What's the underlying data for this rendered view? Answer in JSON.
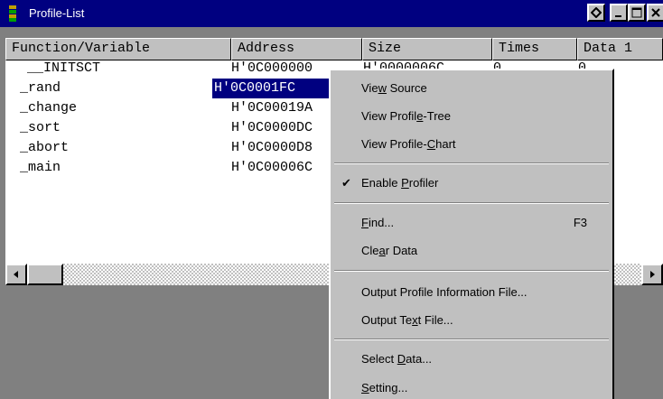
{
  "window": {
    "title": "Profile-List",
    "buttons": [
      "restore-special",
      "minimize",
      "maximize",
      "close"
    ]
  },
  "columns": [
    "Function/Variable",
    "Address",
    "Size",
    "Times",
    "Data 1"
  ],
  "rows": [
    {
      "name": "__INITSCT",
      "address": "H'0C000000",
      "size": "H'0000006C",
      "times": "0",
      "data1": "0"
    },
    {
      "name": "_rand",
      "address": "H'0C0001FC",
      "size": "",
      "times": "",
      "data1": ""
    },
    {
      "name": "_change",
      "address": "H'0C00019A",
      "size": "",
      "times": "",
      "data1": ""
    },
    {
      "name": "_sort",
      "address": "H'0C0000DC",
      "size": "",
      "times": "",
      "data1": ""
    },
    {
      "name": "_abort",
      "address": "H'0C0000D8",
      "size": "",
      "times": "",
      "data1": ""
    },
    {
      "name": "_main",
      "address": "H'0C00006C",
      "size": "",
      "times": "",
      "data1": ""
    }
  ],
  "menu": {
    "view_source": {
      "pre": "Vie",
      "acc": "w",
      "post": " Source"
    },
    "view_profile_tree": {
      "pre": "View Profil",
      "acc": "e",
      "post": "-Tree"
    },
    "view_profile_chart": {
      "pre": "View Profile-",
      "acc": "C",
      "post": "hart"
    },
    "enable_profiler": {
      "pre": "Enable ",
      "acc": "P",
      "post": "rofiler",
      "checked": true,
      "check_glyph": "✔"
    },
    "find": {
      "pre": "",
      "acc": "F",
      "post": "ind...",
      "shortcut": "F3"
    },
    "clear_data": {
      "pre": "Cle",
      "acc": "a",
      "post": "r Data"
    },
    "output_profile": {
      "pre": "Output Profile Information File...",
      "acc": "",
      "post": ""
    },
    "output_text": {
      "pre": "Output Te",
      "acc": "x",
      "post": "t File..."
    },
    "select_data": {
      "pre": "Select ",
      "acc": "D",
      "post": "ata..."
    },
    "setting": {
      "pre": "",
      "acc": "S",
      "post": "etting..."
    }
  }
}
